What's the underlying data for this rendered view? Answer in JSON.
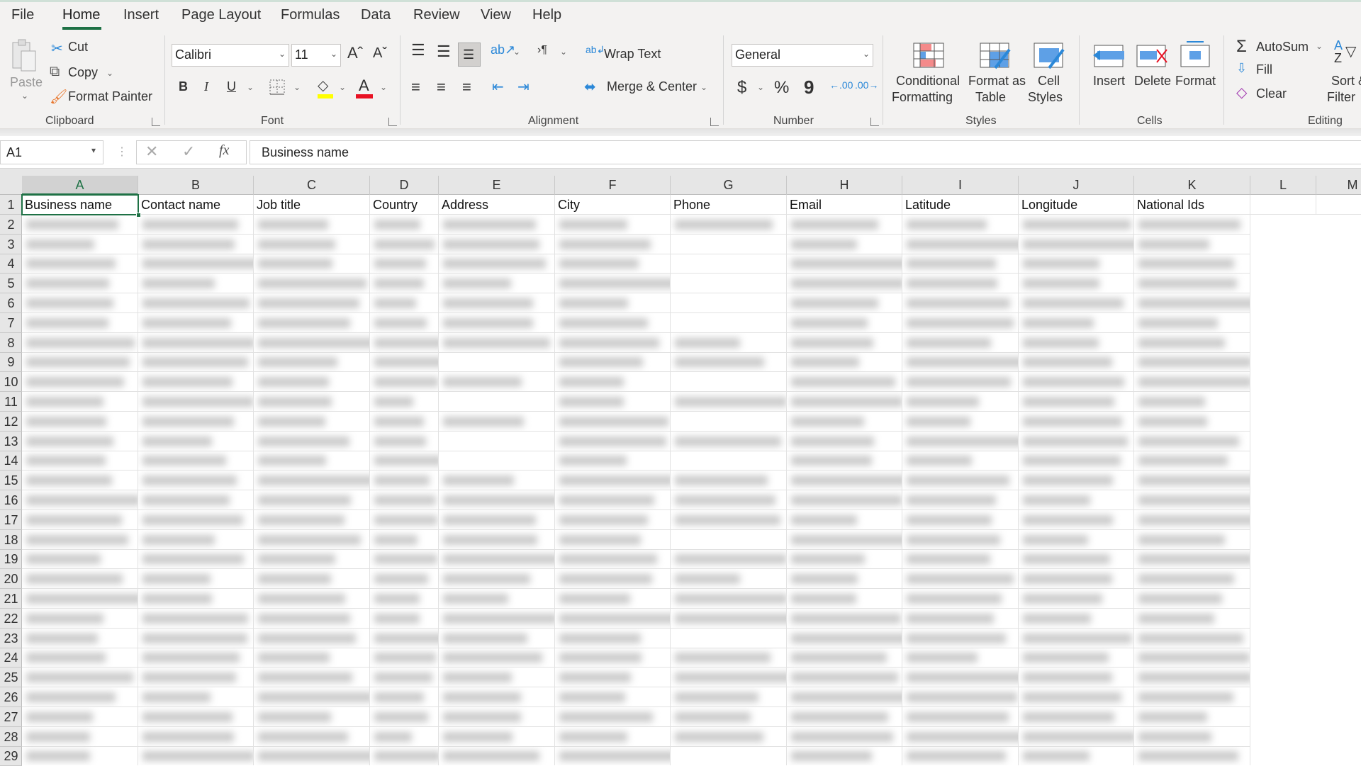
{
  "menu": {
    "tabs": [
      {
        "label": "File"
      },
      {
        "label": "Home",
        "active": true
      },
      {
        "label": "Insert"
      },
      {
        "label": "Page Layout"
      },
      {
        "label": "Formulas"
      },
      {
        "label": "Data"
      },
      {
        "label": "Review"
      },
      {
        "label": "View"
      },
      {
        "label": "Help"
      }
    ]
  },
  "ribbon": {
    "clipboard": {
      "paste": "Paste",
      "cut": "Cut",
      "copy": "Copy",
      "format_painter": "Format Painter",
      "group": "Clipboard"
    },
    "font": {
      "font_name": "Calibri",
      "font_size": "11",
      "bold": "B",
      "italic": "I",
      "underline": "U",
      "group": "Font",
      "fill_color": "#ffff00",
      "font_color": "#e81123"
    },
    "alignment": {
      "wrap_text": "Wrap Text",
      "merge_center": "Merge & Center",
      "group": "Alignment"
    },
    "number": {
      "format": "General",
      "currency": "$",
      "percent": "%",
      "comma": "9",
      "group": "Number"
    },
    "styles": {
      "conditional_formatting": [
        "Conditional",
        "Formatting"
      ],
      "format_as_table": [
        "Format as",
        "Table"
      ],
      "cell_styles": [
        "Cell",
        "Styles"
      ],
      "group": "Styles"
    },
    "cells": {
      "insert": "Insert",
      "delete": "Delete",
      "format": "Format",
      "group": "Cells"
    },
    "editing": {
      "autosum": "AutoSum",
      "fill": "Fill",
      "clear": "Clear",
      "sort_filter": [
        "Sort &",
        "Filter"
      ],
      "group": "Editing"
    }
  },
  "formula_bar": {
    "name_box": "A1",
    "fx": "fx",
    "formula": "Business name"
  },
  "sheet": {
    "columns": [
      "A",
      "B",
      "C",
      "D",
      "E",
      "F",
      "G",
      "H",
      "I",
      "J",
      "K",
      "L",
      "M"
    ],
    "selected_column": "A",
    "selected_cell": "A1",
    "rows": [
      "1",
      "2",
      "3",
      "4",
      "5",
      "6",
      "7",
      "8",
      "9",
      "10",
      "11",
      "12",
      "13",
      "14",
      "15",
      "16",
      "17",
      "18",
      "19",
      "20",
      "21",
      "22",
      "23",
      "24",
      "25",
      "26",
      "27",
      "28",
      "29"
    ],
    "headers": [
      "Business name",
      "Contact name",
      "Job title",
      "Country",
      "Address",
      "City",
      "Phone",
      "Email",
      "Latitude",
      "Longitude",
      "National Ids",
      "",
      ""
    ],
    "data_note": "rows 2-29 content blurred"
  },
  "colors": {
    "accent": "#1e7145"
  }
}
